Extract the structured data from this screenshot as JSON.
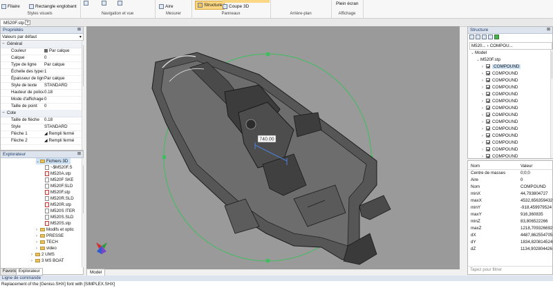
{
  "ribbon": {
    "items": [
      {
        "label": "Filaire",
        "icon": "wireframe-icon"
      },
      {
        "label": "Rectangle englobant",
        "icon": "bounding-box-icon"
      },
      {
        "label": "Aire",
        "icon": "area-icon"
      },
      {
        "label": "Structure",
        "icon": "structure-icon"
      },
      {
        "label": "Coupe 3D",
        "icon": "section-3d-icon"
      },
      {
        "label": "Plein écran",
        "icon": "fullscreen-icon"
      }
    ],
    "groups": [
      "Styles visuels",
      "Navigation et vue",
      "Mesurer",
      "Panneaux",
      "Arrière-plan",
      "Affichage"
    ]
  },
  "doc_tab": "M520F.stp",
  "properties": {
    "title": "Propriétés",
    "dropdown": "Valeurs par défaut",
    "rows": [
      {
        "type": "cat",
        "key": "Général"
      },
      {
        "type": "prop",
        "key": "Couleur",
        "value": "Par calque"
      },
      {
        "type": "prop",
        "key": "Calque",
        "value": "0"
      },
      {
        "type": "prop",
        "key": "Type de ligne",
        "value": "Par calque"
      },
      {
        "type": "prop",
        "key": "Échelle des types d",
        "value": "1"
      },
      {
        "type": "prop",
        "key": "Épaisseur de ligne",
        "value": "Par calque"
      },
      {
        "type": "prop",
        "key": "Style de texte",
        "value": "STANDARD"
      },
      {
        "type": "prop",
        "key": "Hauteur de police",
        "value": "0.18"
      },
      {
        "type": "prop",
        "key": "Mode d'affichage d",
        "value": "0"
      },
      {
        "type": "prop",
        "key": "Taille de point",
        "value": "0"
      },
      {
        "type": "cat",
        "key": "Cote"
      },
      {
        "type": "prop",
        "key": "Taille de flèche",
        "value": "0.18"
      },
      {
        "type": "prop",
        "key": "Style",
        "value": "STANDARD"
      },
      {
        "type": "prop",
        "key": "Flèche 1",
        "value": "Rempli fermé"
      },
      {
        "type": "prop",
        "key": "Flèche 2",
        "value": "Rempli fermé"
      }
    ]
  },
  "explorer": {
    "title": "Explorateur",
    "items": [
      {
        "label": "Fichiers 3D",
        "kind": "folder",
        "indent": 1,
        "selected": true
      },
      {
        "label": "~$M520F.S",
        "kind": "file",
        "indent": 2
      },
      {
        "label": "M520A.stp",
        "kind": "pdf",
        "indent": 2
      },
      {
        "label": "M520F SKE",
        "kind": "file",
        "indent": 2
      },
      {
        "label": "M520F.SLD",
        "kind": "file",
        "indent": 2
      },
      {
        "label": "M520F.stp",
        "kind": "pdf",
        "indent": 2
      },
      {
        "label": "M520R.SLD",
        "kind": "file",
        "indent": 2
      },
      {
        "label": "M520R.stp",
        "kind": "pdf",
        "indent": 2
      },
      {
        "label": "M520S ITER",
        "kind": "file",
        "indent": 2
      },
      {
        "label": "M520S.SLD",
        "kind": "file",
        "indent": 2
      },
      {
        "label": "M520S.stp",
        "kind": "pdf",
        "indent": 2
      },
      {
        "label": "Modifs et optic",
        "kind": "folder",
        "indent": 1
      },
      {
        "label": "PRESSE",
        "kind": "folder",
        "indent": 1
      },
      {
        "label": "TECH",
        "kind": "folder",
        "indent": 1
      },
      {
        "label": "video",
        "kind": "folder",
        "indent": 1
      },
      {
        "label": "2 UMS",
        "kind": "folder",
        "indent": 0
      },
      {
        "label": "3 MS BOAT",
        "kind": "folder",
        "indent": 0
      }
    ],
    "bottom_tabs": [
      "Favoris",
      "Explorateur"
    ]
  },
  "viewport": {
    "tab": "Model",
    "dimension_label": "740.00"
  },
  "structure": {
    "title": "Structure",
    "breadcrumb": [
      "M520...",
      "COMPOU..."
    ],
    "tree": [
      {
        "label": "Model",
        "indent": 0,
        "checkbox": false
      },
      {
        "label": "M520F.stp",
        "indent": 1,
        "checkbox": false
      },
      {
        "label": "COMPOUND",
        "indent": 2,
        "checkbox": true,
        "selected": true
      },
      {
        "label": "COMPOUND",
        "indent": 2,
        "checkbox": true
      },
      {
        "label": "COMPOUND",
        "indent": 2,
        "checkbox": true
      },
      {
        "label": "COMPOUND",
        "indent": 2,
        "checkbox": true
      },
      {
        "label": "COMPOUND",
        "indent": 2,
        "checkbox": true
      },
      {
        "label": "COMPOUND",
        "indent": 2,
        "checkbox": true
      },
      {
        "label": "COMPOUND",
        "indent": 2,
        "checkbox": true
      },
      {
        "label": "COMPOUND",
        "indent": 2,
        "checkbox": true
      },
      {
        "label": "COMPOUND",
        "indent": 2,
        "checkbox": true
      },
      {
        "label": "COMPOUND",
        "indent": 2,
        "checkbox": true
      },
      {
        "label": "COMPOUND",
        "indent": 2,
        "checkbox": true
      },
      {
        "label": "COMPOUND",
        "indent": 2,
        "checkbox": true
      },
      {
        "label": "COMPOUND",
        "indent": 2,
        "checkbox": true
      },
      {
        "label": "COMPOUND",
        "indent": 2,
        "checkbox": true
      }
    ]
  },
  "info": {
    "header": [
      "Nom",
      "Valeur"
    ],
    "rows": [
      [
        "Centre de masses",
        "0;0;0"
      ],
      [
        "Aire",
        "0"
      ],
      [
        "Nom",
        "COMPOUND"
      ],
      [
        "minX",
        "44,793804727"
      ],
      [
        "maxX",
        "4532,656359432"
      ],
      [
        "minY",
        "-918,459979524"
      ],
      [
        "maxY",
        "916,360835"
      ],
      [
        "minZ",
        "83,806522266"
      ],
      [
        "maxZ",
        "1218,709326692"
      ],
      [
        "dX",
        "4487,862554705"
      ],
      [
        "dY",
        "1834,820814524"
      ],
      [
        "dZ",
        "1134,902804426"
      ]
    ],
    "filter_placeholder": "Tapez pour filtrer"
  },
  "command": {
    "title": "Ligne de commande",
    "line": "Replacement of the [Geniso.SHX] font with [SIMPLEX.SHX]"
  }
}
